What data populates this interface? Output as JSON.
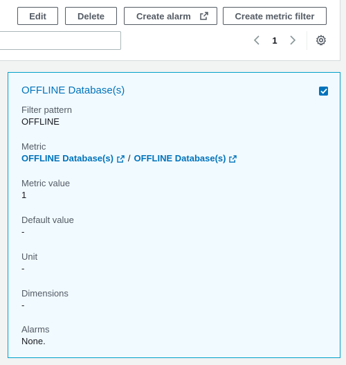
{
  "toolbar": {
    "edit_label": "Edit",
    "delete_label": "Delete",
    "create_alarm_label": "Create alarm",
    "create_metric_filter_label": "Create metric filter"
  },
  "search": {
    "value": "",
    "placeholder": ""
  },
  "pagination": {
    "current_page": "1"
  },
  "card": {
    "title": "OFFLINE Database(s)",
    "selected": true,
    "filter_pattern_label": "Filter pattern",
    "filter_pattern_value": "OFFLINE",
    "metric_label": "Metric",
    "metric_namespace": "OFFLINE Database(s)",
    "metric_separator": "/",
    "metric_name": "OFFLINE Database(s)",
    "metric_value_label": "Metric value",
    "metric_value": "1",
    "default_value_label": "Default value",
    "default_value": "-",
    "unit_label": "Unit",
    "unit_value": "-",
    "dimensions_label": "Dimensions",
    "dimensions_value": "-",
    "alarms_label": "Alarms",
    "alarms_value": "None."
  },
  "colors": {
    "link": "#0073bb",
    "card_border": "#00a1c9",
    "card_background": "#f1faff",
    "button_border": "#545b64"
  },
  "icons": [
    "external-link-icon",
    "chevron-left-icon",
    "chevron-right-icon",
    "gear-icon",
    "checkmark-icon"
  ]
}
